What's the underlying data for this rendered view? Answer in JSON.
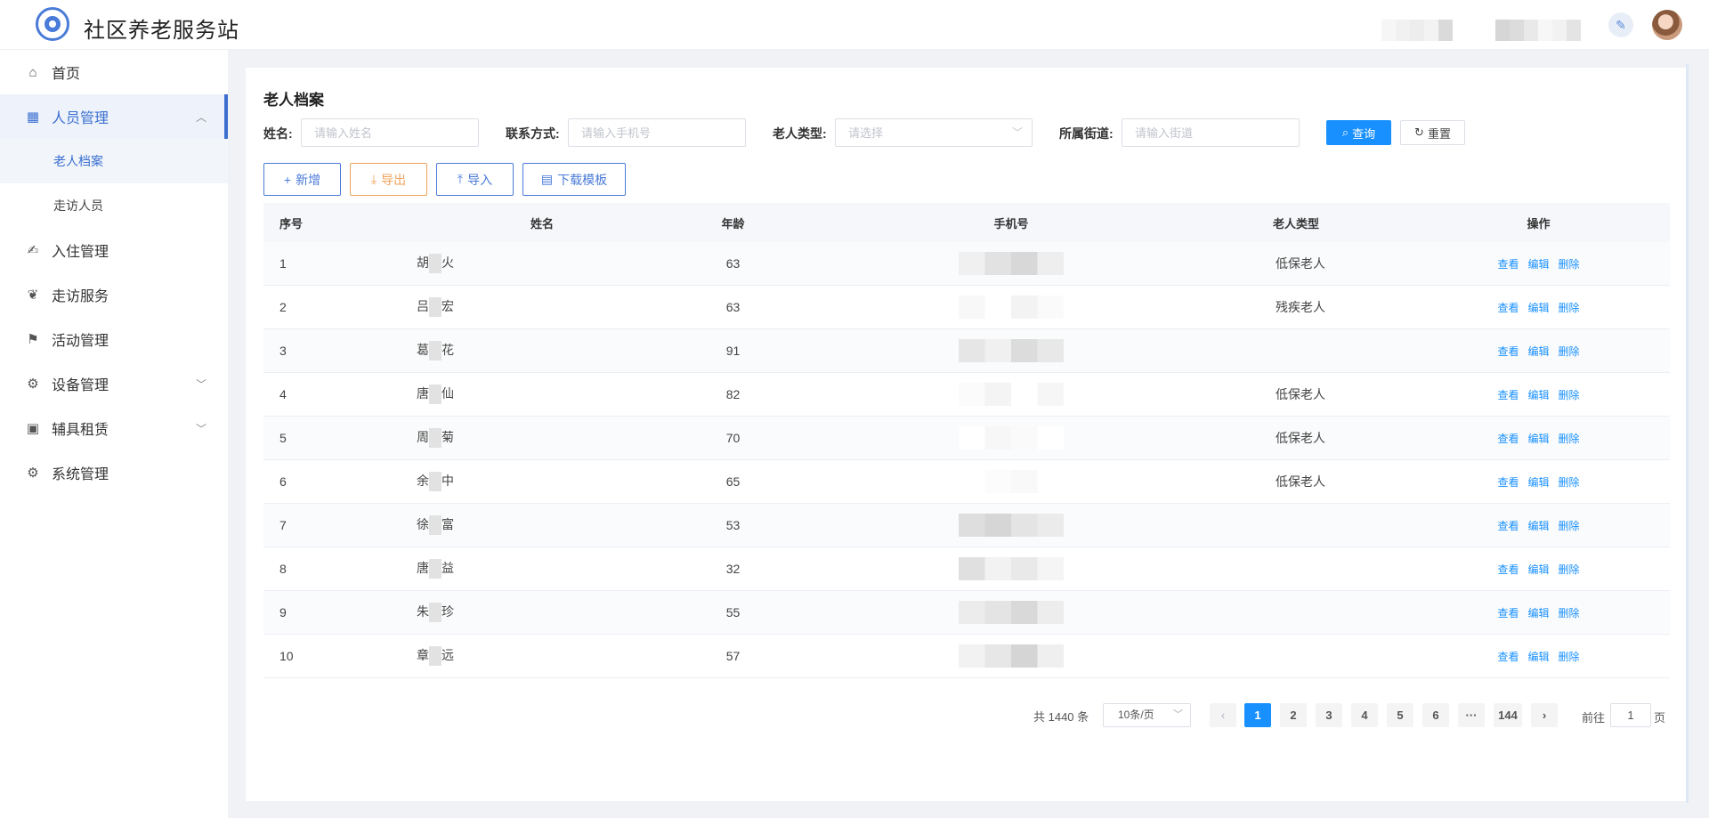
{
  "header": {
    "site_title": "社区养老服务站"
  },
  "sidebar": {
    "items": [
      {
        "label": "首页",
        "icon": "home-icon"
      },
      {
        "label": "人员管理",
        "icon": "people-management-icon",
        "expanded": true
      },
      {
        "label": "老人档案"
      },
      {
        "label": "走访人员"
      },
      {
        "label": "入住管理",
        "icon": "check-in-icon"
      },
      {
        "label": "走访服务",
        "icon": "visit-service-icon"
      },
      {
        "label": "活动管理",
        "icon": "flag-icon"
      },
      {
        "label": "设备管理",
        "icon": "gear-icon"
      },
      {
        "label": "辅具租赁",
        "icon": "monitor-icon"
      },
      {
        "label": "系统管理",
        "icon": "settings-icon"
      }
    ]
  },
  "page": {
    "title": "老人档案"
  },
  "search": {
    "name_label": "姓名:",
    "name_placeholder": "请输入姓名",
    "phone_label": "联系方式:",
    "phone_placeholder": "请输入手机号",
    "type_label": "老人类型:",
    "type_placeholder": "请选择",
    "street_label": "所属街道:",
    "street_placeholder": "请输入街道",
    "query_label": "查询",
    "reset_label": "重置"
  },
  "toolbar": {
    "add_label": "新增",
    "export_label": "导出",
    "import_label": "导入",
    "template_label": "下载模板"
  },
  "table": {
    "headers": {
      "index": "序号",
      "name": "姓名",
      "age": "年龄",
      "phone": "手机号",
      "type": "老人类型",
      "ops": "操作"
    },
    "ops": {
      "view": "查看",
      "edit": "编辑",
      "delete": "删除"
    },
    "rows": [
      {
        "index": "1",
        "name_first": "胡",
        "name_last": "火",
        "age": "63",
        "type": "低保老人"
      },
      {
        "index": "2",
        "name_first": "吕",
        "name_last": "宏",
        "age": "63",
        "type": "残疾老人"
      },
      {
        "index": "3",
        "name_first": "葛",
        "name_last": "花",
        "age": "91",
        "type": ""
      },
      {
        "index": "4",
        "name_first": "唐",
        "name_last": "仙",
        "age": "82",
        "type": "低保老人"
      },
      {
        "index": "5",
        "name_first": "周",
        "name_last": "菊",
        "age": "70",
        "type": "低保老人"
      },
      {
        "index": "6",
        "name_first": "余",
        "name_last": "中",
        "age": "65",
        "type": "低保老人"
      },
      {
        "index": "7",
        "name_first": "徐",
        "name_last": "富",
        "age": "53",
        "type": ""
      },
      {
        "index": "8",
        "name_first": "唐",
        "name_last": "益",
        "age": "32",
        "type": ""
      },
      {
        "index": "9",
        "name_first": "朱",
        "name_last": "珍",
        "age": "55",
        "type": ""
      },
      {
        "index": "10",
        "name_first": "章",
        "name_last": "远",
        "age": "57",
        "type": ""
      }
    ]
  },
  "pagination": {
    "total": "共 1440 条",
    "page_size": "10条/页",
    "pages": [
      "1",
      "2",
      "3",
      "4",
      "5",
      "6"
    ],
    "ellipsis": "···",
    "last_page": "144",
    "current": "1",
    "goto_prefix": "前往",
    "goto_value": "1",
    "goto_suffix": "页"
  },
  "colors": {
    "primary": "#1890ff",
    "brand": "#3a6fd0",
    "warning": "#f0a35a"
  }
}
